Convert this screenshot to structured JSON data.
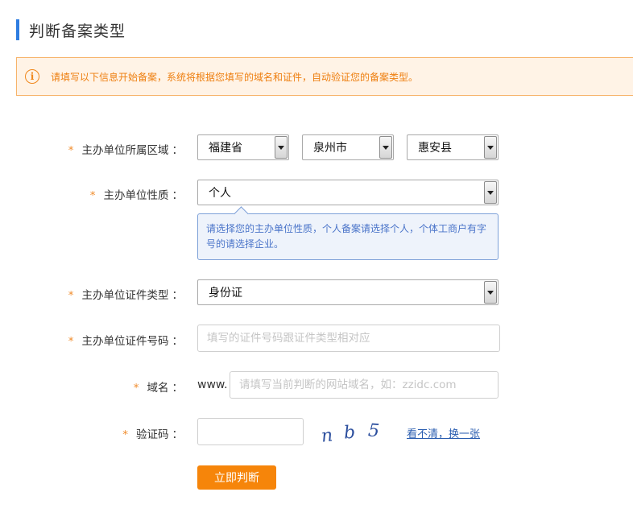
{
  "header": {
    "title": "判断备案类型"
  },
  "notice": {
    "icon": "info-icon",
    "icon_glyph": "i",
    "text": "请填写以下信息开始备案，系统将根据您填写的域名和证件，自动验证您的备案类型。"
  },
  "form": {
    "required_mark": "*",
    "colon": "：",
    "region": {
      "label": "主办单位所属区域",
      "province": "福建省",
      "city": "泉州市",
      "county": "惠安县"
    },
    "nature": {
      "label": "主办单位性质",
      "value": "个人",
      "tip": "请选择您的主办单位性质，个人备案请选择个人，个体工商户有字号的请选择企业。"
    },
    "cert_type": {
      "label": "主办单位证件类型",
      "value": "身份证"
    },
    "cert_number": {
      "label": "主办单位证件号码",
      "value": "",
      "placeholder": "填写的证件号码跟证件类型相对应"
    },
    "domain": {
      "label": "域名",
      "prefix": "www.",
      "value": "",
      "placeholder": "请填写当前判断的网站域名，如：zzidc.com"
    },
    "captcha": {
      "label": "验证码",
      "value": "",
      "image_text": "nb5",
      "refresh_label": "看不清，换一张"
    },
    "submit_label": "立即判断"
  },
  "colors": {
    "accent_blue": "#2e7de1",
    "notice_orange": "#ee7f10",
    "button_orange": "#f6850a",
    "link_blue": "#2a5db0"
  }
}
